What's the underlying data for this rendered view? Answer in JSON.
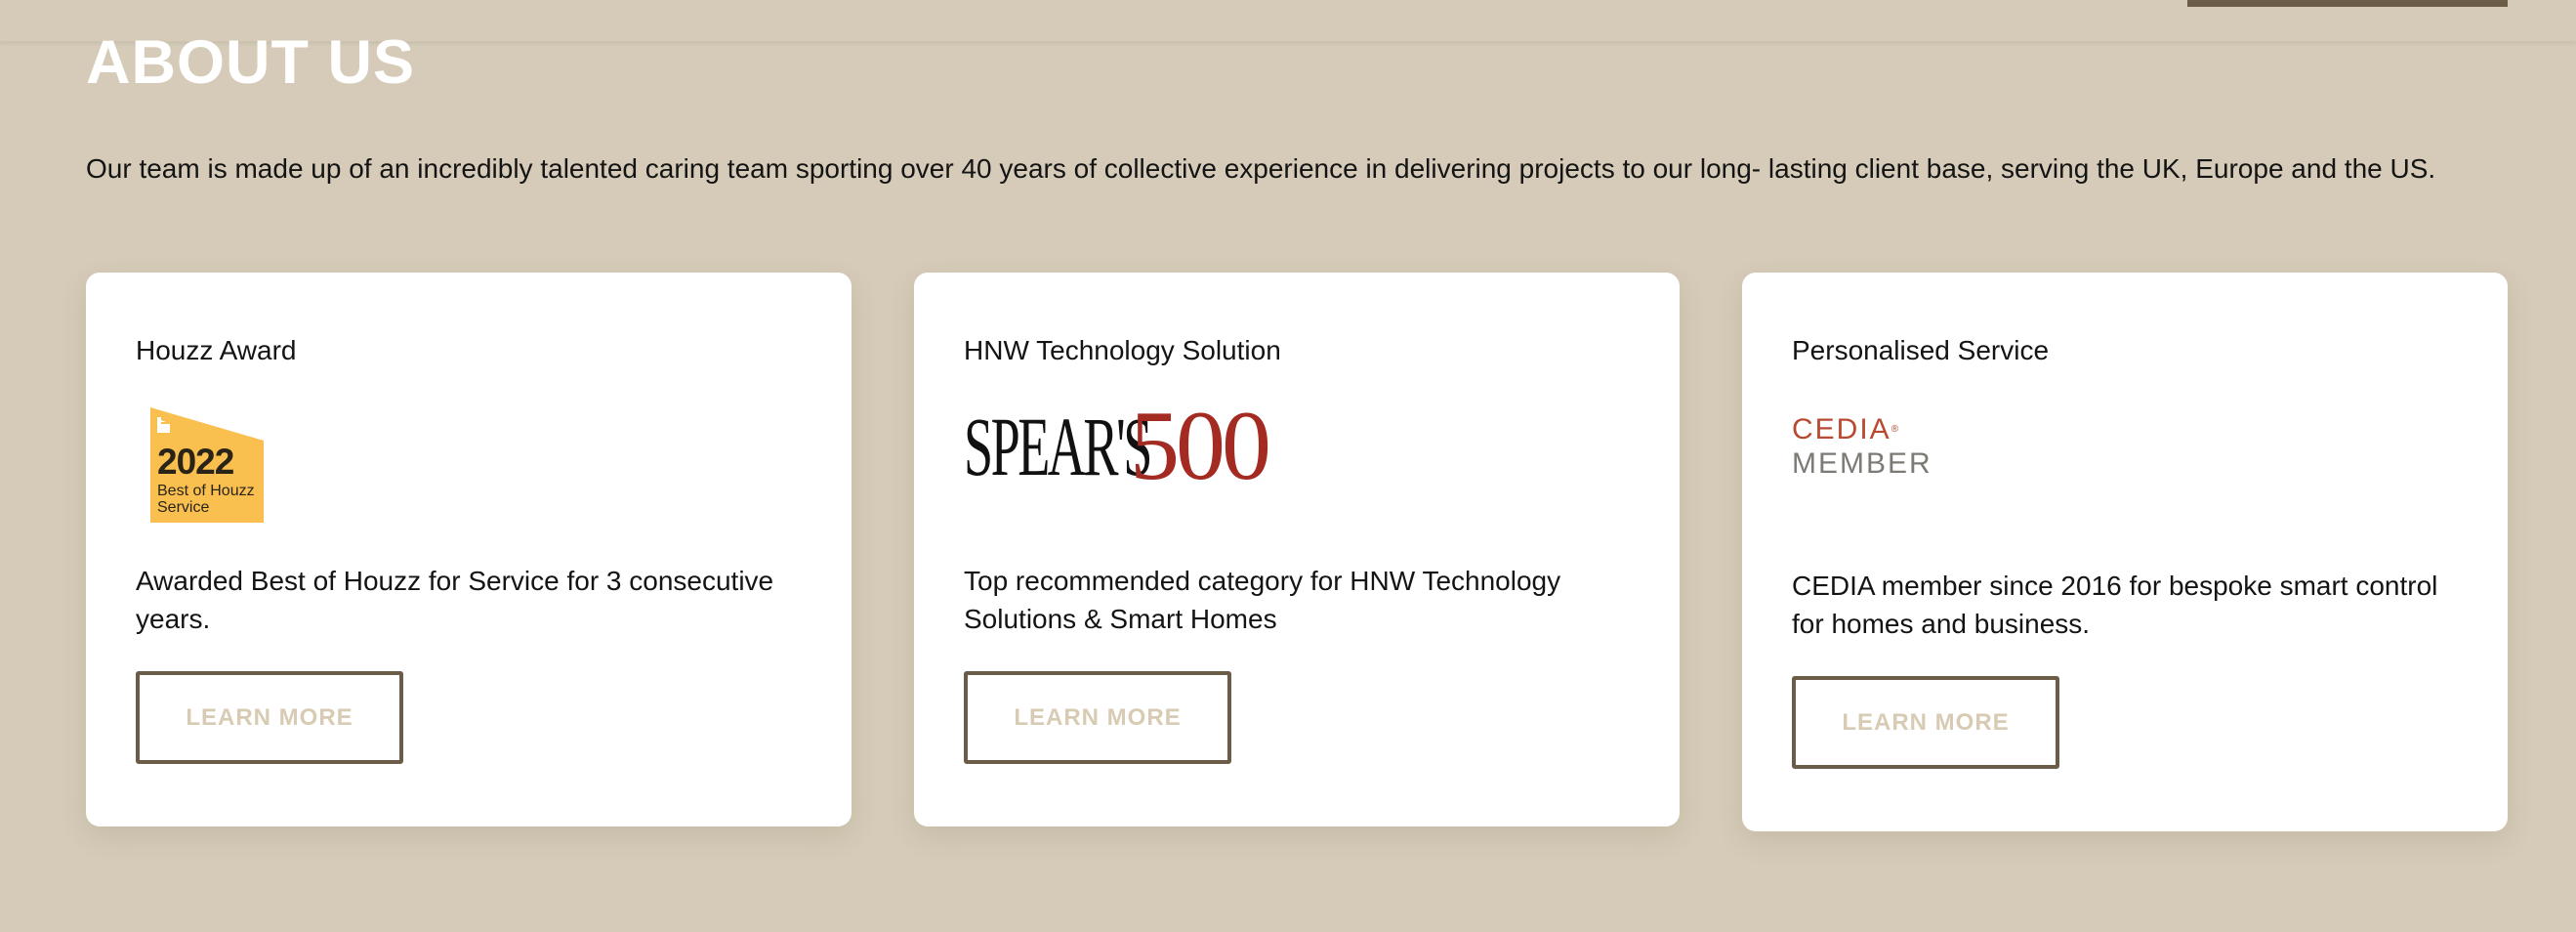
{
  "page": {
    "title": "ABOUT US",
    "intro": "Our team is made up of an incredibly talented caring team sporting over 40 years of collective experience in delivering projects to our long- lasting client base, serving the UK, Europe and the US."
  },
  "cards": [
    {
      "title": "Houzz Award",
      "logo": {
        "icon": "houzz-best-of-badge",
        "year": "2022",
        "line1": "Best of Houzz",
        "line2": "Service",
        "color": "#f9c04f"
      },
      "description": "Awarded Best of Houzz for Service for 3 consecutive years.",
      "button_label": "LEARN MORE"
    },
    {
      "title": "HNW Technology Solution",
      "logo": {
        "icon": "spears-500-logo",
        "word": "SPEAR'S",
        "number": "500",
        "number_color": "#a32b22"
      },
      "description": "Top recommended category for HNW Technology Solutions & Smart Homes",
      "button_label": "LEARN MORE"
    },
    {
      "title": "Personalised Service",
      "logo": {
        "icon": "cedia-member-logo",
        "word": "CEDIA",
        "mark": "®",
        "member": "MEMBER",
        "color": "#b84a32"
      },
      "description": "CEDIA member since 2016 for bespoke smart control for homes and business.",
      "button_label": "LEARN MORE"
    }
  ],
  "colors": {
    "background": "#d5cbb8",
    "card": "#ffffff",
    "button_border": "#6b5c48",
    "button_text": "#d8cbb3",
    "title": "#ffffff"
  }
}
